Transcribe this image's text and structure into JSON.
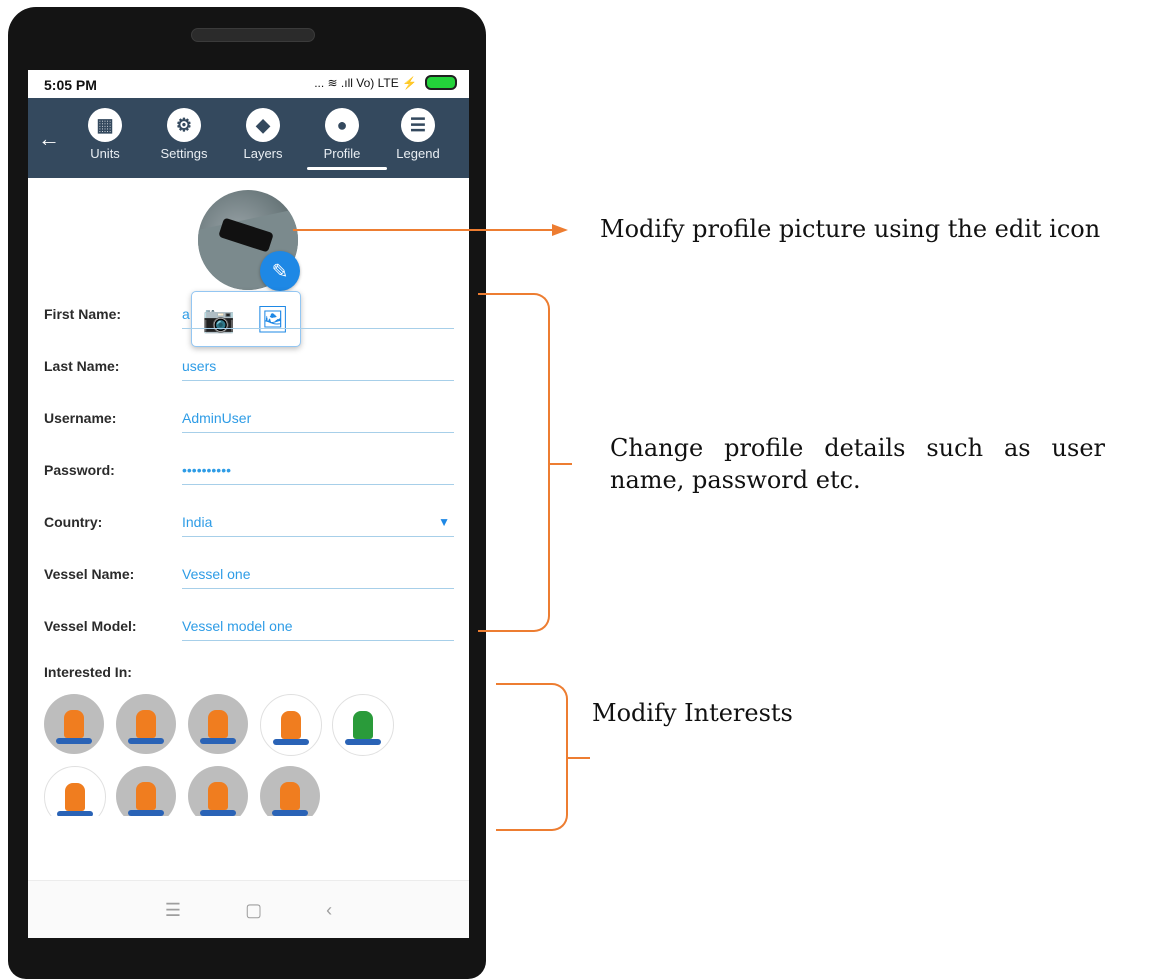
{
  "status_bar": {
    "time": "5:05 PM",
    "icons_text": "... ≋ .ıll Vo) LTE ⚡"
  },
  "top_nav": {
    "tabs": [
      {
        "label": "Units",
        "icon": "units-icon"
      },
      {
        "label": "Settings",
        "icon": "gear-icon"
      },
      {
        "label": "Layers",
        "icon": "layers-icon"
      },
      {
        "label": "Profile",
        "icon": "user-icon",
        "active": true
      },
      {
        "label": "Legend",
        "icon": "legend-icon"
      }
    ]
  },
  "profile": {
    "avatar_alt": "profile photo",
    "edit_icon": "pencil-icon",
    "picker": {
      "camera_icon": "camera-icon",
      "gallery_icon": "gallery-icon"
    }
  },
  "form": {
    "first_name": {
      "label": "First Name:",
      "value": "a"
    },
    "last_name": {
      "label": "Last Name:",
      "value": "users"
    },
    "username": {
      "label": "Username:",
      "value": "AdminUser"
    },
    "password": {
      "label": "Password:",
      "value": "••••••••••"
    },
    "country": {
      "label": "Country:",
      "value": "India",
      "caret": "▼"
    },
    "vessel_name": {
      "label": "Vessel Name:",
      "value": "Vessel one"
    },
    "vessel_model": {
      "label": "Vessel Model:",
      "value": "Vessel model one"
    }
  },
  "interests": {
    "label": "Interested In:",
    "items": [
      {
        "icon": "fishing-icon",
        "style": "gray"
      },
      {
        "icon": "jetski-icon",
        "style": "gray"
      },
      {
        "icon": "kitesurf-icon",
        "style": "gray"
      },
      {
        "icon": "paddleboard-icon",
        "style": "light"
      },
      {
        "icon": "sailboat-icon",
        "style": "light"
      },
      {
        "icon": "sailing-icon",
        "style": "light"
      },
      {
        "icon": "surf-icon",
        "style": "gray"
      },
      {
        "icon": "wakeboard-icon",
        "style": "gray"
      },
      {
        "icon": "waterski-icon",
        "style": "gray"
      }
    ]
  },
  "system_nav": {
    "menu": "☰",
    "home": "▢",
    "back": "‹"
  },
  "annotations": {
    "profile_picture": "Modify profile picture using the edit icon",
    "profile_details": "Change profile details such as user name, password etc.",
    "interests": "Modify Interests"
  },
  "colors": {
    "accent": "#1e88e5",
    "nav_bg": "#34495e",
    "annotation": "#ed7d31"
  }
}
